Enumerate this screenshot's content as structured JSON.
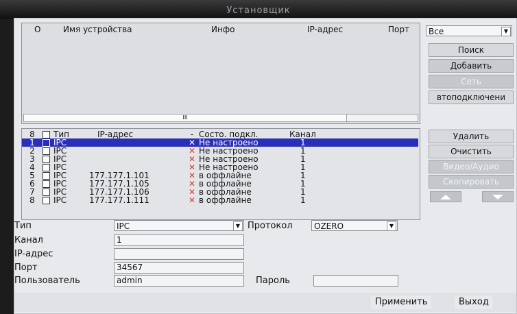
{
  "window": {
    "title": "Установщик"
  },
  "device_list": {
    "headers": {
      "col_o": "O",
      "name": "Имя устройства",
      "info": "Инфо",
      "ip": "IP-адрес",
      "port": "Порт"
    },
    "scroll_marker": "III"
  },
  "filter": {
    "value": "Все"
  },
  "search_buttons": {
    "search": "Поиск",
    "add": "Добавить",
    "network": "Сеть",
    "autoconnect": "втоподключени"
  },
  "added": {
    "headers": {
      "count": "8",
      "type": "Тип",
      "ip": "IP-адрес",
      "dash": "-",
      "state": "Состо. подкл.",
      "channel": "Канал"
    },
    "rows": [
      {
        "n": "1",
        "type": "IPC",
        "ip": "",
        "state": "Не настроено",
        "channel": "1"
      },
      {
        "n": "2",
        "type": "IPC",
        "ip": "",
        "state": "Не настроено",
        "channel": "1"
      },
      {
        "n": "3",
        "type": "IPC",
        "ip": "",
        "state": "Не настроено",
        "channel": "1"
      },
      {
        "n": "4",
        "type": "IPC",
        "ip": "",
        "state": "Не настроено",
        "channel": "1"
      },
      {
        "n": "5",
        "type": "IPC",
        "ip": "177.177.1.101",
        "state": "в оффлайне",
        "channel": "1"
      },
      {
        "n": "6",
        "type": "IPC",
        "ip": "177.177.1.105",
        "state": "в оффлайне",
        "channel": "1"
      },
      {
        "n": "7",
        "type": "IPC",
        "ip": "177.177.1.106",
        "state": "в оффлайне",
        "channel": "1"
      },
      {
        "n": "8",
        "type": "IPC",
        "ip": "177.177.1.111",
        "state": "в оффлайне",
        "channel": "1"
      }
    ],
    "selected_row": 0,
    "x_mark": "✕"
  },
  "added_buttons": {
    "delete": "Удалить",
    "clear": "Очистить",
    "video_audio": "Видео/Аудио",
    "copy": "Скопировать"
  },
  "form": {
    "type_label": "Тип",
    "type_value": "IPC",
    "protocol_label": "Протокол",
    "protocol_value": "OZERO",
    "channel_label": "Канал",
    "channel_value": "1",
    "ip_label": "IP-адрес",
    "ip_value": "",
    "port_label": "Порт",
    "port_value": "34567",
    "user_label": "Пользователь",
    "user_value": "admin",
    "password_label": "Пароль",
    "password_value": ""
  },
  "footer": {
    "apply": "Применить",
    "exit": "Выход"
  },
  "colors": {
    "selection": "#2a2fb8",
    "status_x": "#e03a2b",
    "background": "#e8e9ec"
  }
}
